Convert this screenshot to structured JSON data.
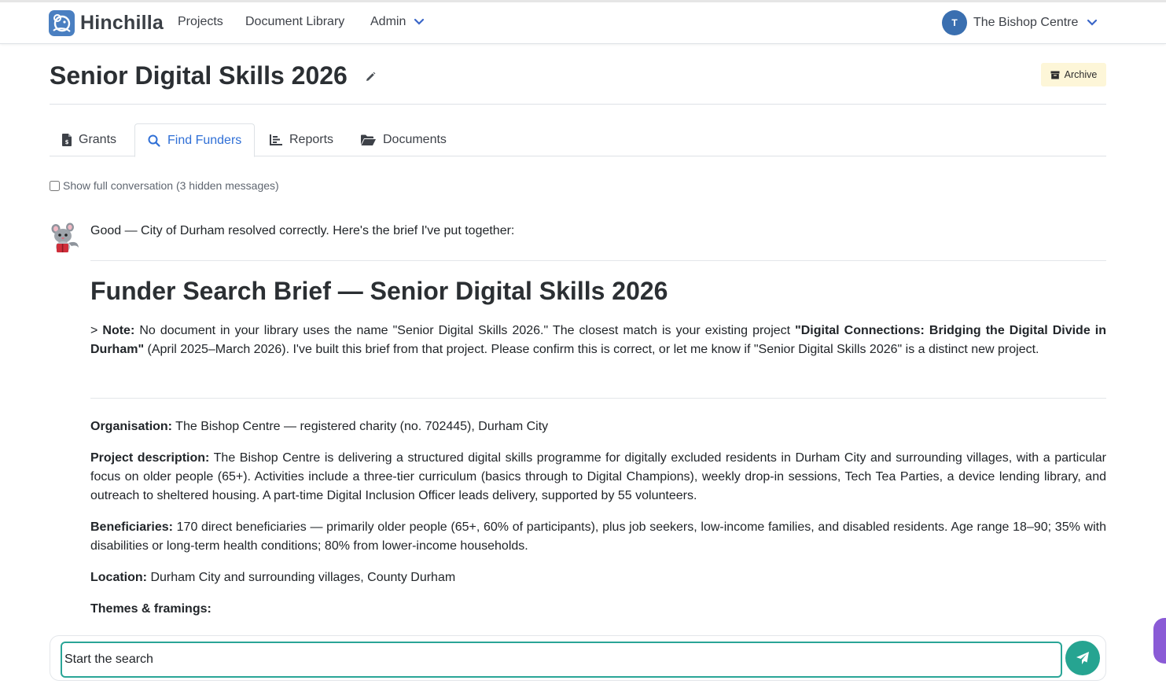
{
  "app": {
    "name": "Hinchilla"
  },
  "nav": {
    "projects": "Projects",
    "library": "Document Library",
    "admin": "Admin",
    "user_initial": "T",
    "user_name": "The Bishop Centre"
  },
  "header": {
    "title": "Senior Digital Skills 2026",
    "archive_label": "Archive"
  },
  "tabs": [
    {
      "label": "Grants",
      "icon": "file-invoice-icon"
    },
    {
      "label": "Find Funders",
      "icon": "search-icon",
      "active": true
    },
    {
      "label": "Reports",
      "icon": "chart-bar-icon"
    },
    {
      "label": "Documents",
      "icon": "folder-open-icon"
    }
  ],
  "conversation": {
    "show_full": "Show full conversation (3 hidden messages)",
    "intro": "Good — City of Durham resolved correctly. Here's the brief I've put together:",
    "brief_title": "Funder Search Brief — Senior Digital Skills 2026",
    "note": {
      "prefix": "> ",
      "label": "Note:",
      "text1": " No document in your library uses the name \"Senior Digital Skills 2026.\" The closest match is your existing project ",
      "project": "\"Digital Connections: Bridging the Digital Divide in Durham\"",
      "text2": " (April 2025–March 2026). I've built this brief from that project. Please confirm this is correct, or let me know if \"Senior Digital Skills 2026\" is a distinct new project."
    },
    "organisation": {
      "label": "Organisation:",
      "text": " The Bishop Centre — registered charity (no. 702445), Durham City"
    },
    "description": {
      "label": "Project description:",
      "text": " The Bishop Centre is delivering a structured digital skills programme for digitally excluded residents in Durham City and surrounding villages, with a particular focus on older people (65+). Activities include a three-tier curriculum (basics through to Digital Champions), weekly drop-in sessions, Tech Tea Parties, a device lending library, and outreach to sheltered housing. A part-time Digital Inclusion Officer leads delivery, supported by 55 volunteers."
    },
    "beneficiaries": {
      "label": "Beneficiaries:",
      "text": " 170 direct beneficiaries — primarily older people (65+, 60% of participants), plus job seekers, low-income families, and disabled residents. Age range 18–90; 35% with disabilities or long-term health conditions; 80% from lower-income households."
    },
    "location": {
      "label": "Location:",
      "text": " Durham City and surrounding villages, County Durham"
    },
    "themes": {
      "label": "Themes & framings:"
    }
  },
  "composer": {
    "value": "Start the search"
  },
  "colors": {
    "accent": "#2aa597",
    "link": "#2f6fd6",
    "brand": "#4a7fc1"
  }
}
